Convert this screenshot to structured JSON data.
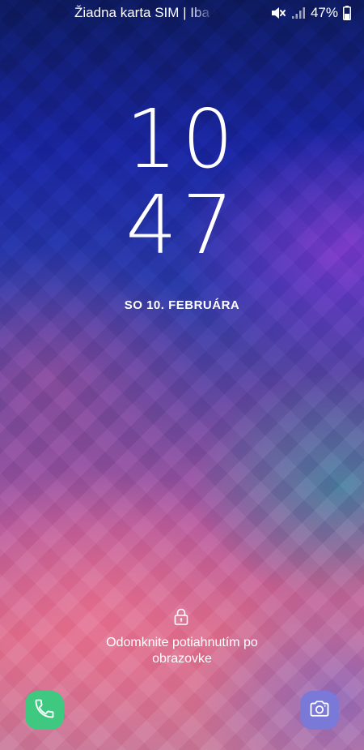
{
  "status_bar": {
    "carrier_text": "Žiadna karta SIM | Iba tiesňové volania",
    "battery_percent": "47%",
    "battery_level": 0.47
  },
  "lockscreen": {
    "time_hours": "10",
    "time_minutes": "47",
    "date": "SO 10. FEBRUÁRA",
    "unlock_hint_line1": "Odomknite potiahnutím po",
    "unlock_hint_line2": "obrazovke"
  },
  "shortcuts": {
    "left": "phone-icon",
    "right": "camera-icon"
  },
  "colors": {
    "phone_shortcut": "#3fc980",
    "camera_shortcut": "#7a79d8"
  }
}
